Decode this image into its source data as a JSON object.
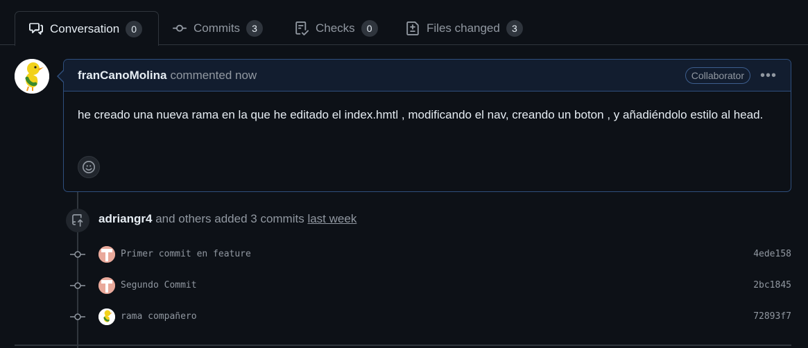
{
  "tabs": [
    {
      "label": "Conversation",
      "count": "0",
      "icon": "comment-discussion-icon",
      "active": true
    },
    {
      "label": "Commits",
      "count": "3",
      "icon": "git-commit-icon",
      "active": false
    },
    {
      "label": "Checks",
      "count": "0",
      "icon": "checklist-icon",
      "active": false
    },
    {
      "label": "Files changed",
      "count": "3",
      "icon": "file-diff-icon",
      "active": false
    }
  ],
  "comment": {
    "author": "franCanoMolina",
    "meta": "commented now",
    "role": "Collaborator",
    "menu": "•••",
    "body": "he creado una nueva rama en la que he editado el index.hmtl , modificando el nav, creando un boton , y añadiéndolo estilo al head."
  },
  "push_event": {
    "author": "adriangr4",
    "text": " and others added 3 commits ",
    "when": "last week"
  },
  "commits": [
    {
      "message": "Primer commit en feature",
      "sha": "4ede158",
      "avatar": "identicon"
    },
    {
      "message": "Segundo Commit",
      "sha": "2bc1845",
      "avatar": "identicon"
    },
    {
      "message": "rama compañero",
      "sha": "72893f7",
      "avatar": "duck"
    }
  ],
  "colors": {
    "background": "#0d1117",
    "border": "#30363d",
    "comment_border": "#2f4f7e",
    "comment_header": "#121d2f",
    "text": "#e6edf3",
    "muted": "#9198a1"
  }
}
